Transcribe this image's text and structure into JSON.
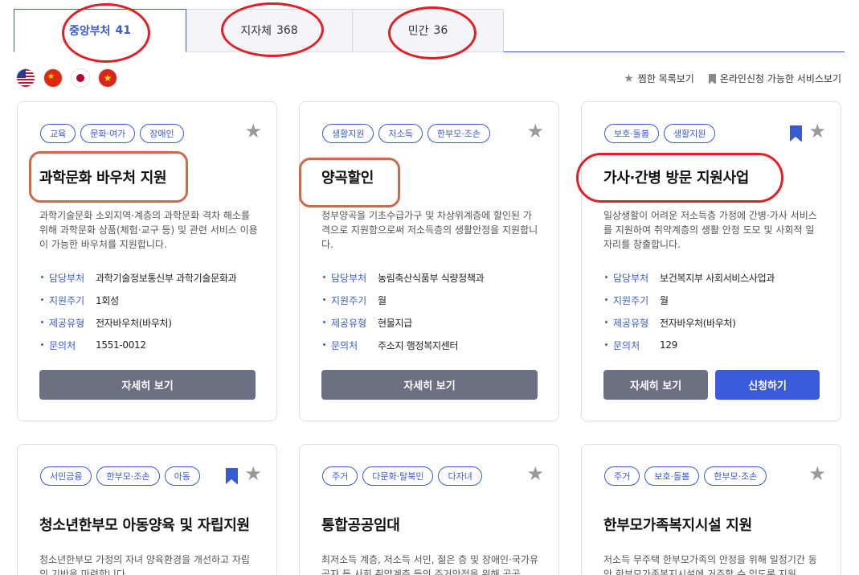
{
  "tabs": [
    {
      "label": "중앙부처",
      "count": "41"
    },
    {
      "label": "지자체",
      "count": "368"
    },
    {
      "label": "민간",
      "count": "36"
    }
  ],
  "flags": [
    "us-flag-icon",
    "cn-flag-icon",
    "jp-flag-icon",
    "vn-flag-icon"
  ],
  "options": {
    "favorites": "찜한 목록보기",
    "online": "온라인신청 가능한 서비스보기"
  },
  "colors": {
    "accent": "#3a5bd0",
    "detail_button": "#6b7083",
    "apply_button": "#3b5bdb",
    "annotation_red": "#e21f26"
  },
  "info_labels": {
    "dept": "담당부처",
    "cycle": "지원주기",
    "type": "제공유형",
    "contact": "문의처"
  },
  "buttons": {
    "detail": "자세히 보기",
    "apply": "신청하기"
  },
  "cards": [
    {
      "tags": [
        "교육",
        "문화·여가",
        "장애인"
      ],
      "title": "과학문화 바우처 지원",
      "desc": "과학기술문화 소외지역·계층의 과학문화 격차 해소를 위해 과학문화 상품(체험·교구 등) 및 관련 서비스 이용이 가능한 바우처를 지원합니다.",
      "dept": "과학기술정보통신부 과학기술문화과",
      "cycle": "1회성",
      "type": "전자바우처(바우처)",
      "contact": "1551-0012"
    },
    {
      "tags": [
        "생활지원",
        "저소득",
        "한부모·조손"
      ],
      "title": "양곡할인",
      "desc": "정부양곡을 기초수급가구 및 차상위계층에 할인된 가격으로 지원함으로써 저소득층의 생활안정을 지원합니다.",
      "dept": "농림축산식품부 식량정책과",
      "cycle": "월",
      "type": "현물지급",
      "contact": "주소지 행정복지센터"
    },
    {
      "tags": [
        "보호·돌봄",
        "생활지원"
      ],
      "title": "가사·간병 방문 지원사업",
      "desc": "일상생활이 어려운 저소득층 가정에 간병·가사 서비스를 지원하여 취약계층의 생활 안정 도모 및 사회적 일자리를 창출합니다.",
      "dept": "보건복지부 사회서비스사업과",
      "cycle": "월",
      "type": "전자바우처(바우처)",
      "contact": "129"
    },
    {
      "tags": [
        "서민금융",
        "한부모·조손",
        "아동"
      ],
      "title": "청소년한부모 아동양육 및 자립지원",
      "desc": "청소년한부모 가정의 자녀 양육환경을 개선하고 자립의 기반을 마련합니다."
    },
    {
      "tags": [
        "주거",
        "다문화·탈북민",
        "다자녀"
      ],
      "title": "통합공공임대",
      "desc": "최저소득 계층, 저소득 서민, 젊은 층 및 장애인·국가유공자 등 사회 취약계층 등의 주거안정을 위해 공공"
    },
    {
      "tags": [
        "주거",
        "보호·돌봄",
        "한부모·조손"
      ],
      "title": "한부모가족복지시설 지원",
      "desc": "저소득 무주택 한부모가족의 안정을 위해 일정기간 동안 한부모가족복지시설에 거주할 수 있도록 지원"
    }
  ]
}
